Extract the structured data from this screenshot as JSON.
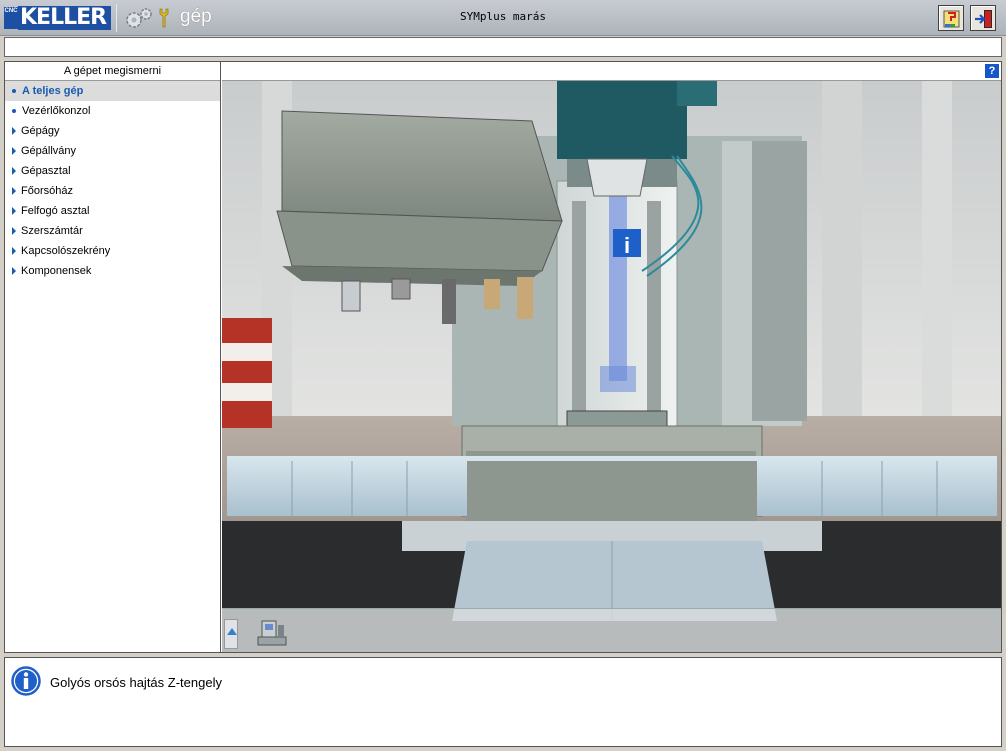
{
  "header": {
    "logo_text": "KELLER",
    "logo_badge": "CNC",
    "module_label": "gép",
    "app_title": "SYMplus marás",
    "icons": {
      "help_book": "book-help-icon",
      "exit": "exit-door-icon",
      "settings": "gears-icon",
      "tool": "wrench-icon"
    }
  },
  "sidebar": {
    "heading": "A gépet megismerni",
    "items": [
      {
        "label": "A teljes gép",
        "marker": "dot",
        "active": true
      },
      {
        "label": "Vezérlőkonzol",
        "marker": "dot",
        "active": false
      },
      {
        "label": "Gépágy",
        "marker": "triangle",
        "active": false
      },
      {
        "label": "Gépállvány",
        "marker": "triangle",
        "active": false
      },
      {
        "label": "Gépasztal",
        "marker": "triangle",
        "active": false
      },
      {
        "label": "Főorsóház",
        "marker": "triangle",
        "active": false
      },
      {
        "label": "Felfogó asztal",
        "marker": "triangle",
        "active": false
      },
      {
        "label": "Szerszámtár",
        "marker": "triangle",
        "active": false
      },
      {
        "label": "Kapcsolószekrény",
        "marker": "triangle",
        "active": false
      },
      {
        "label": "Komponensek",
        "marker": "triangle",
        "active": false
      }
    ]
  },
  "viewer": {
    "help_label": "?",
    "hotspot_label": "i"
  },
  "info": {
    "text": "Golyós orsós hajtás Z-tengely"
  },
  "colors": {
    "accent": "#1a5bb0",
    "logo_blue": "#1d4fa3",
    "highlight_axis": "#5a7ce0"
  }
}
